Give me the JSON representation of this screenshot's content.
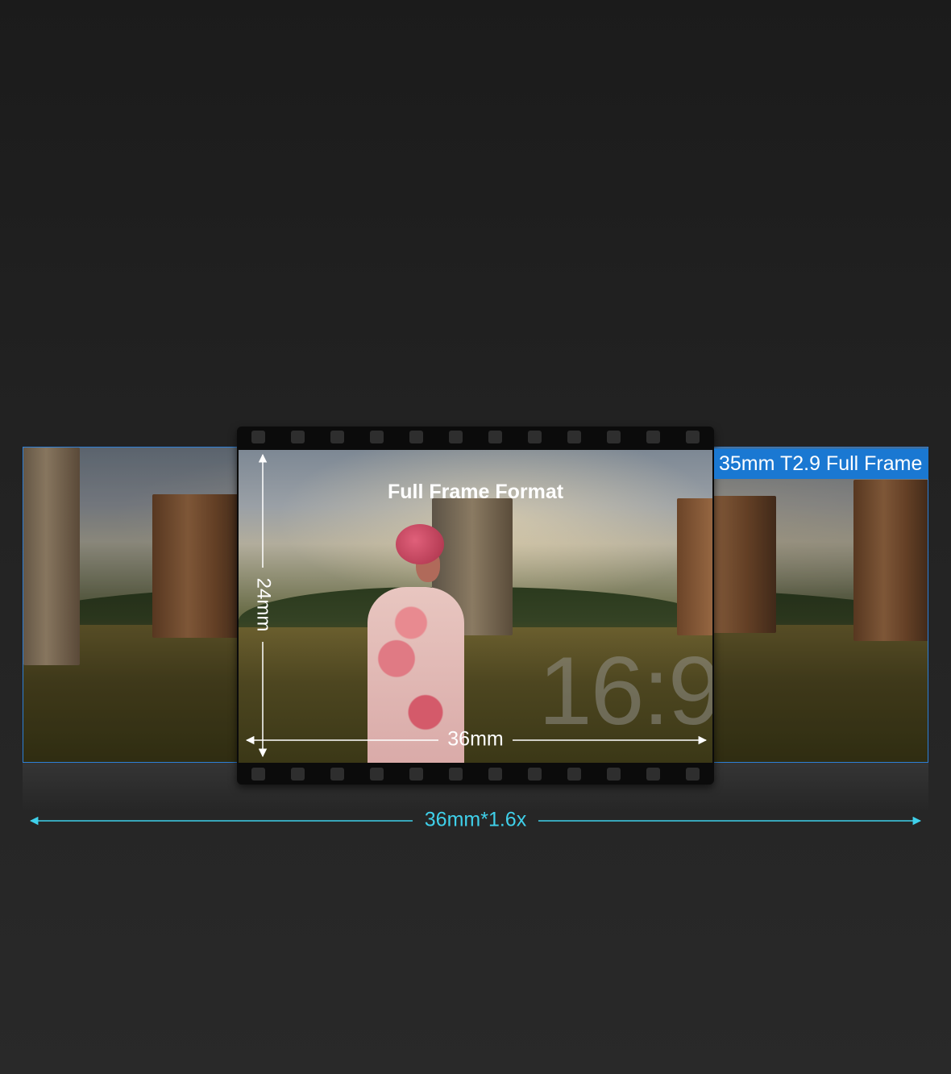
{
  "diagram": {
    "inner_title": "Full Frame Format",
    "wide_label": "35mm T2.9 Full Frame",
    "height_label": "24mm",
    "width_label": "36mm",
    "wide_width_label": "36mm*1.6x",
    "aspect_ratio": "16:9"
  },
  "colors": {
    "wide_frame_border": "#2e7fd6",
    "label_background": "#1a78d2",
    "wide_dimension_line": "#3fd0ea",
    "inner_dimension_line": "#ffffff"
  },
  "film": {
    "sprocket_holes_per_edge": 12
  }
}
